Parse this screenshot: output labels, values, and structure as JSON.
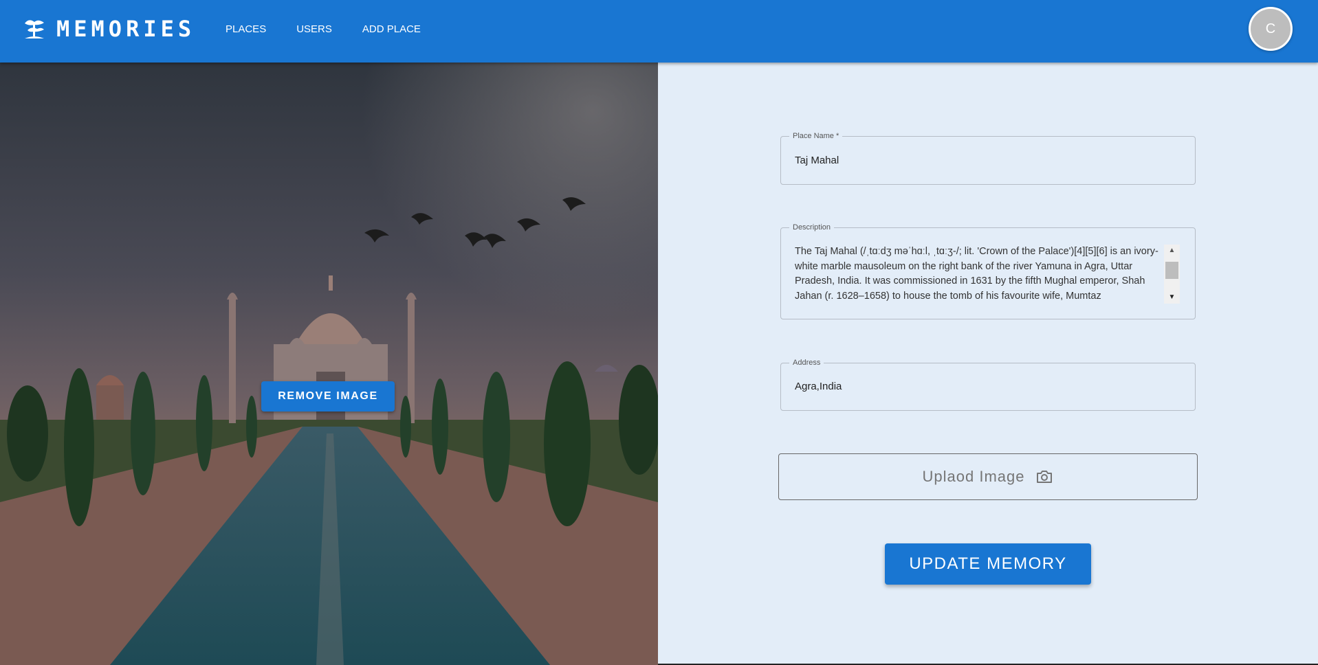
{
  "app": {
    "brand": "MEMORIES",
    "nav": [
      "PLACES",
      "USERS",
      "ADD PLACE"
    ],
    "avatar_initial": "C",
    "accent": "#1976d2"
  },
  "image_panel": {
    "subject": "Taj Mahal photo",
    "remove_label": "REMOVE IMAGE"
  },
  "form": {
    "place_name": {
      "label": "Place Name *",
      "value": "Taj Mahal"
    },
    "description": {
      "label": "Description",
      "value": "The Taj Mahal (/ˌtɑːdʒ məˈhɑːl, ˌtɑːʒ-/; lit. 'Crown of the Palace')[4][5][6] is an ivory-white marble mausoleum on the right bank of the river Yamuna in Agra, Uttar Pradesh, India. It was commissioned in 1631 by the fifth Mughal emperor, Shah Jahan (r. 1628–1658) to house the tomb of his favourite wife, Mumtaz"
    },
    "address": {
      "label": "Address",
      "value": "Agra,India"
    },
    "upload_label": "Uplaod Image",
    "upload_icon": "camera-icon",
    "submit_label": "UPDATE MEMORY"
  }
}
